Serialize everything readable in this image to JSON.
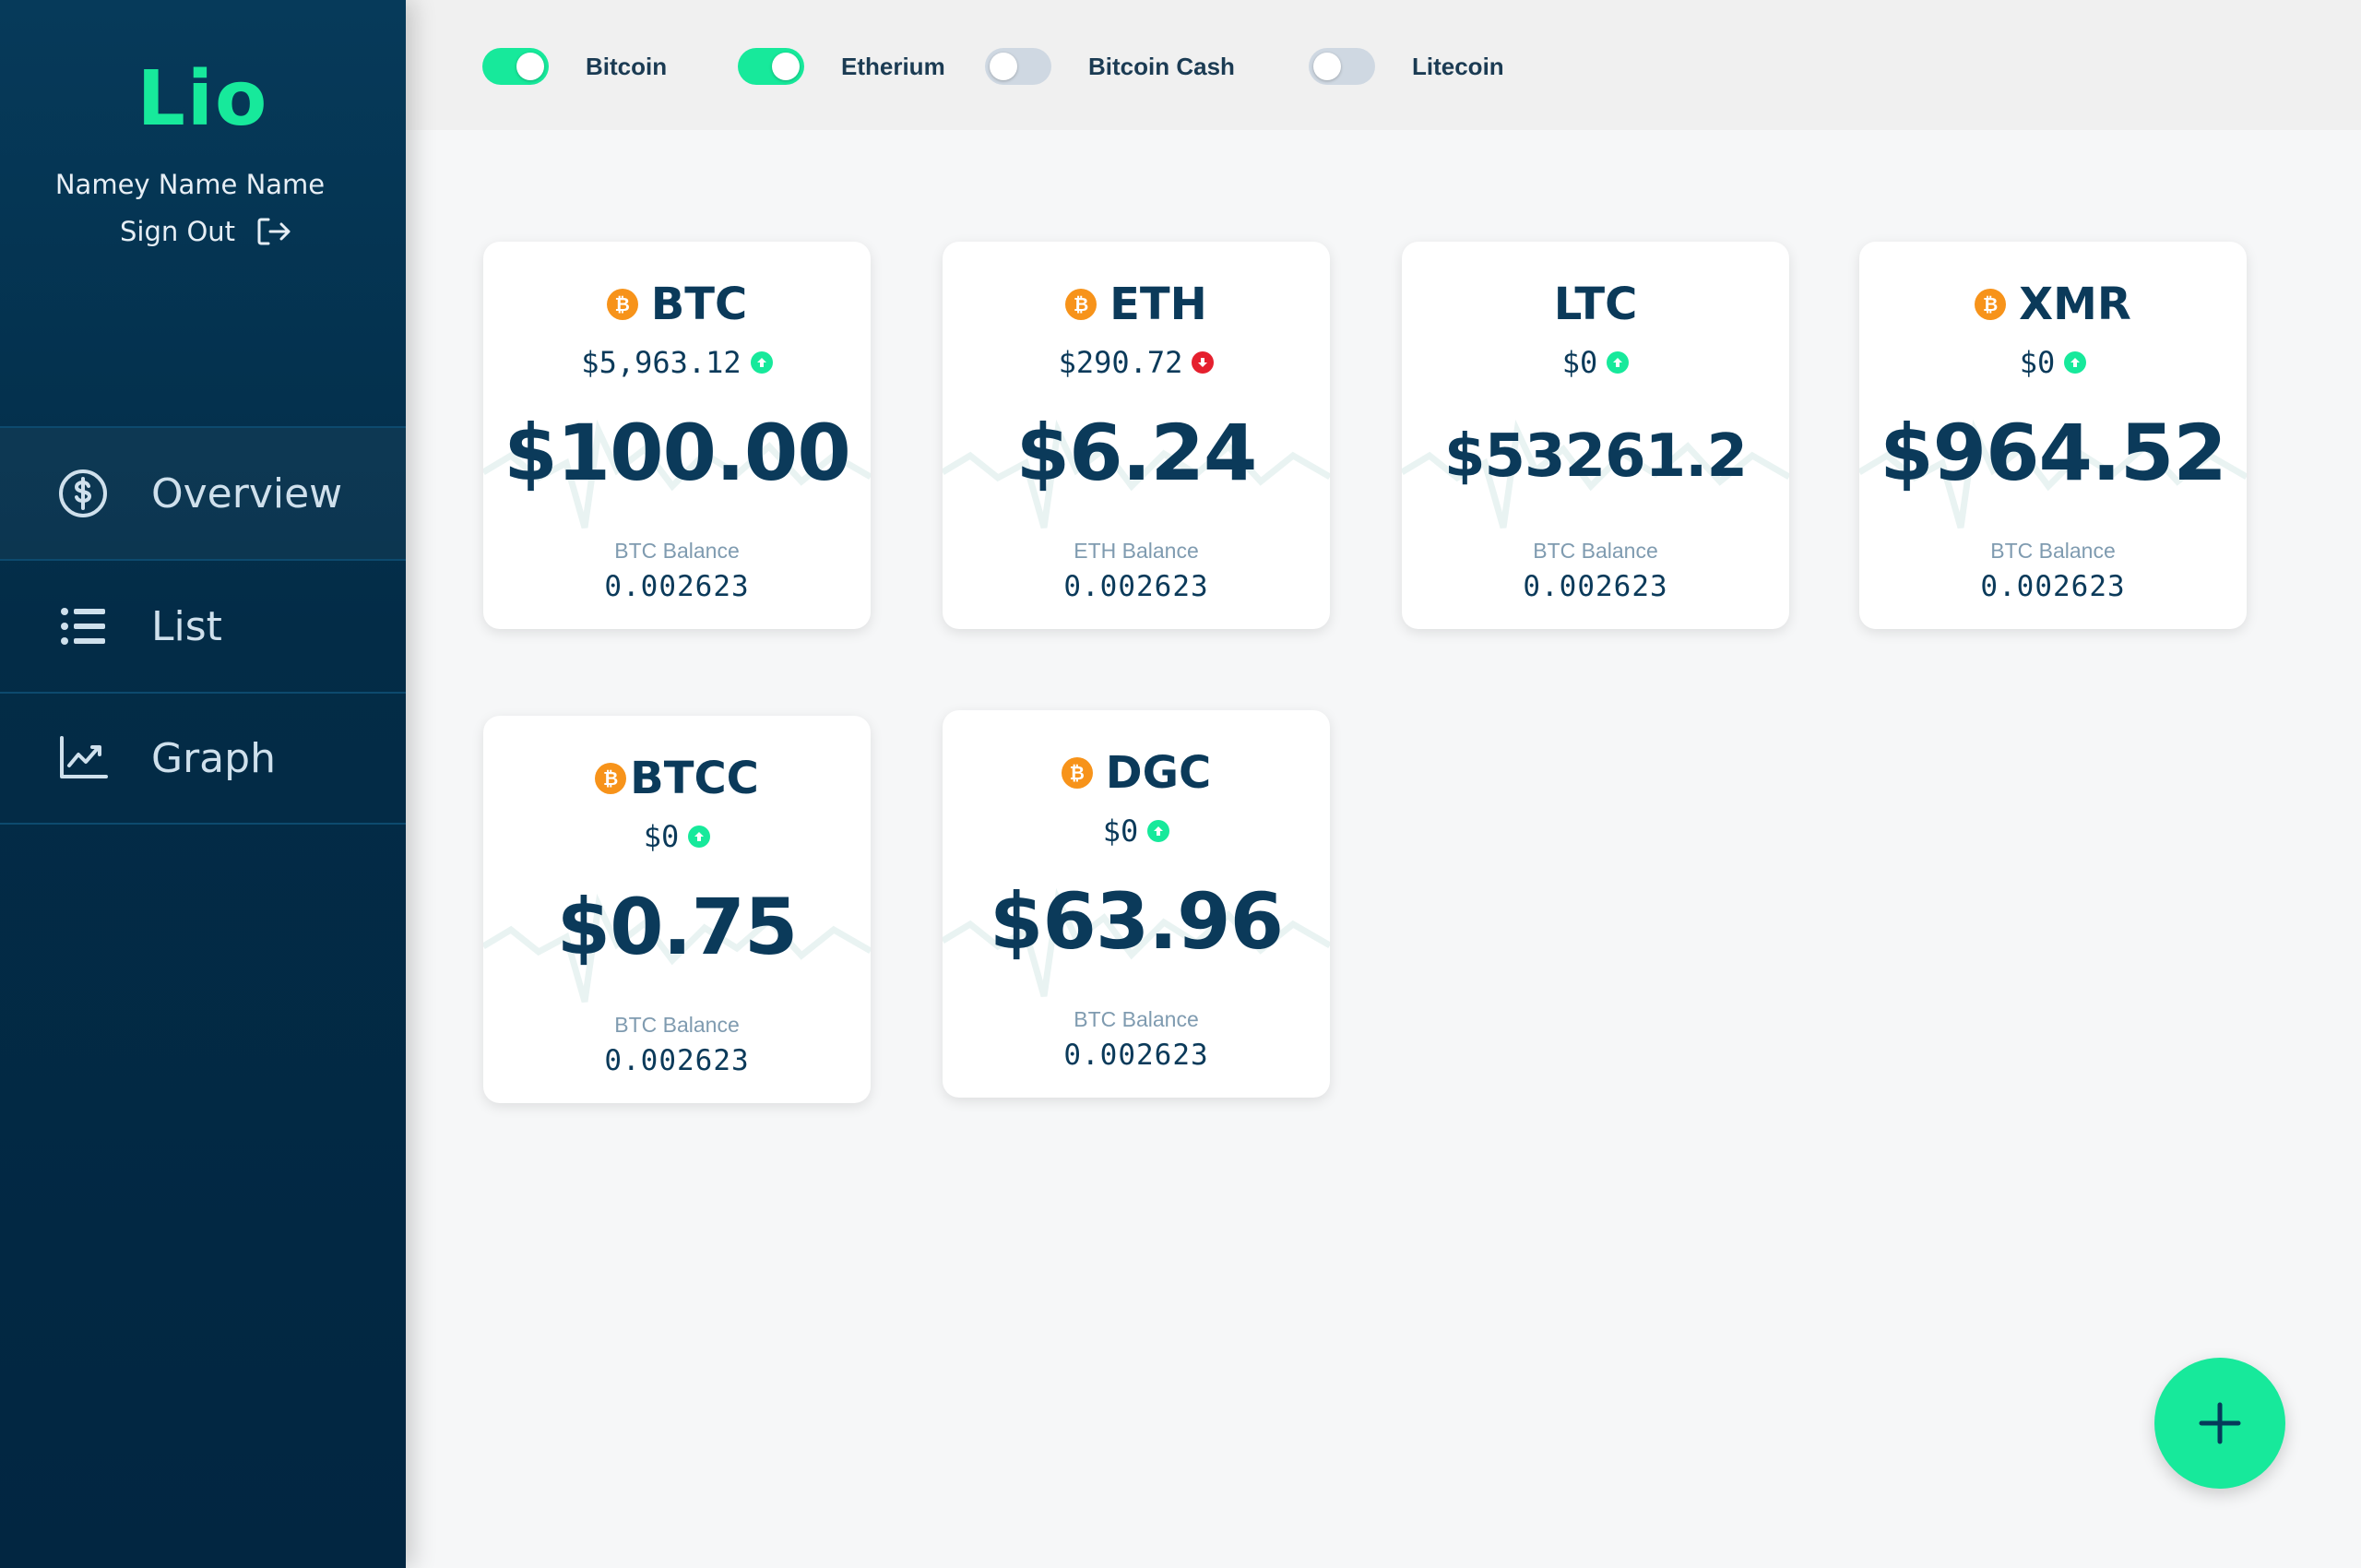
{
  "sidebar": {
    "brand": "Lio",
    "username": "Namey Name Name",
    "signout_label": "Sign Out",
    "nav": [
      {
        "label": "Overview",
        "icon": "dollar-circle-icon"
      },
      {
        "label": "List",
        "icon": "list-icon"
      },
      {
        "label": "Graph",
        "icon": "chart-line-icon"
      }
    ]
  },
  "toggles": [
    {
      "label": "Bitcoin",
      "on": true
    },
    {
      "label": "Etherium",
      "on": true
    },
    {
      "label": "Bitcoin Cash",
      "on": false
    },
    {
      "label": "Litecoin",
      "on": false
    }
  ],
  "cards": [
    {
      "symbol": "BTC",
      "price": "$5,963.12",
      "trend": "up",
      "value": "$100.00",
      "balance_label": "BTC Balance",
      "balance": "0.002623",
      "coin_icon": true
    },
    {
      "symbol": "ETH",
      "price": "$290.72",
      "trend": "down",
      "value": "$6.24",
      "balance_label": "ETH Balance",
      "balance": "0.002623",
      "coin_icon": true
    },
    {
      "symbol": "LTC",
      "price": "$0",
      "trend": "up",
      "value": "$53261.2",
      "balance_label": "BTC Balance",
      "balance": "0.002623",
      "coin_icon": false
    },
    {
      "symbol": "XMR",
      "price": "$0",
      "trend": "up",
      "value": "$964.52",
      "balance_label": "BTC Balance",
      "balance": "0.002623",
      "coin_icon": true
    },
    {
      "symbol": "BTCC",
      "price": "$0",
      "trend": "up",
      "value": "$0.75",
      "balance_label": "BTC Balance",
      "balance": "0.002623",
      "coin_icon": true
    },
    {
      "symbol": "DGC",
      "price": "$0",
      "trend": "up",
      "value": "$63.96",
      "balance_label": "BTC Balance",
      "balance": "0.002623",
      "coin_icon": true
    }
  ],
  "coin_icon_glyph": "₿",
  "fab_icon": "plus-icon",
  "colors": {
    "accent": "#17e99b",
    "navy": "#0b3a5a",
    "down": "#e5202e",
    "coin": "#f7931a"
  }
}
